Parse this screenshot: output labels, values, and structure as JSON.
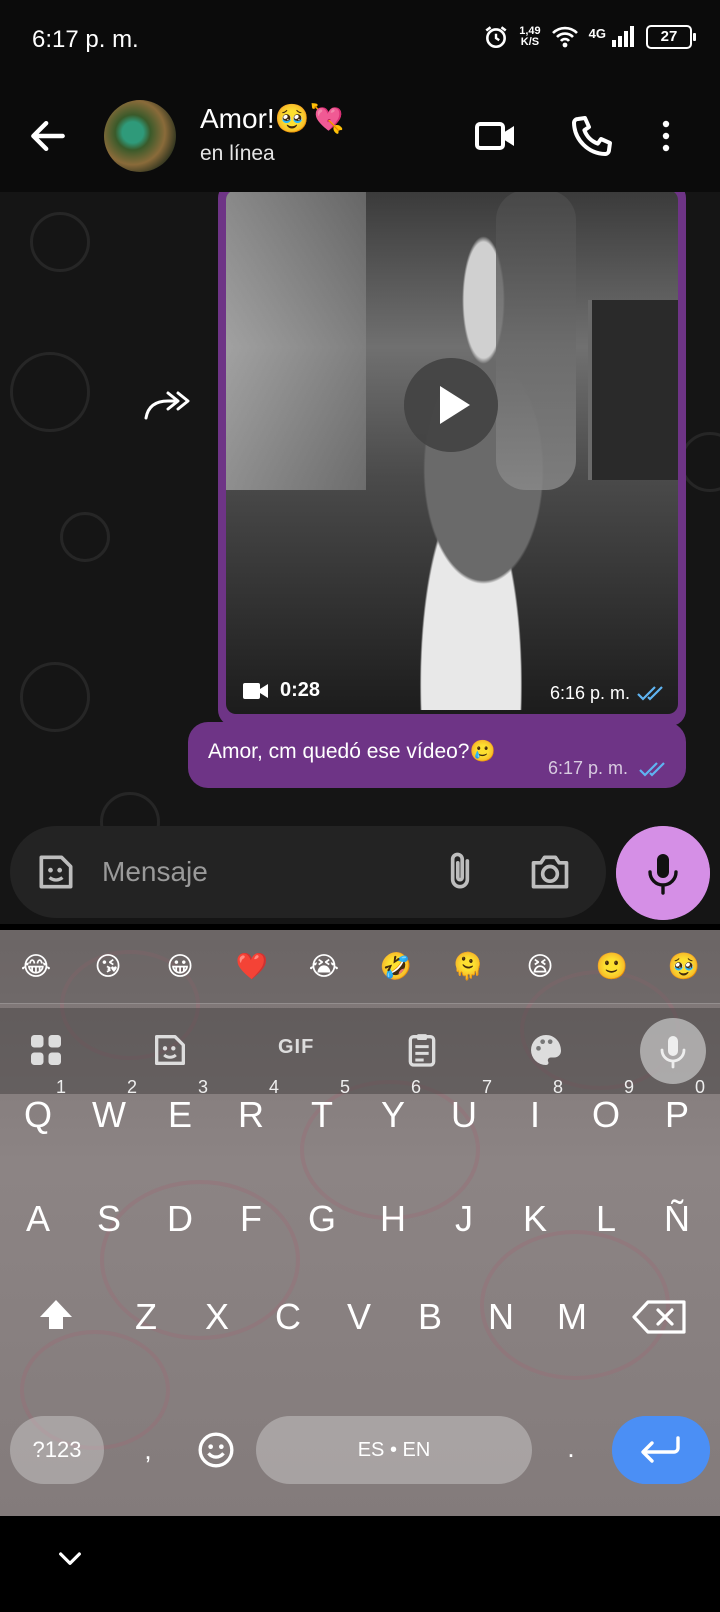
{
  "status_bar": {
    "time": "6:17 p. m.",
    "speed_value": "1,49",
    "speed_unit": "K/S",
    "network": "4G",
    "battery": "27"
  },
  "header": {
    "contact_name": "Amor!🥹💘",
    "contact_status": "en línea",
    "icons": [
      "back-arrow-icon",
      "video-call-icon",
      "voice-call-icon",
      "more-vert-icon"
    ]
  },
  "messages": {
    "video": {
      "duration": "0:28",
      "time": "6:16 p. m.",
      "status": "read"
    },
    "text": {
      "body": "Amor, cm quedó ese vídeo?🥲",
      "time": "6:17 p. m.",
      "status": "read"
    }
  },
  "composer": {
    "placeholder": "Mensaje"
  },
  "keyboard": {
    "emoji_suggestions": [
      "😂",
      "😘",
      "😀",
      "❤️",
      "😭",
      "🤣",
      "🫠",
      "😫",
      "🙂",
      "🥹"
    ],
    "toolbar": {
      "gif": "GIF"
    },
    "row1": [
      "Q",
      "W",
      "E",
      "R",
      "T",
      "Y",
      "U",
      "I",
      "O",
      "P"
    ],
    "row1_numbers": [
      "1",
      "2",
      "3",
      "4",
      "5",
      "6",
      "7",
      "8",
      "9",
      "0"
    ],
    "row2": [
      "A",
      "S",
      "D",
      "F",
      "G",
      "H",
      "J",
      "K",
      "L",
      "Ñ"
    ],
    "row3": [
      "Z",
      "X",
      "C",
      "V",
      "B",
      "N",
      "M"
    ],
    "symbols": "?123",
    "comma": ",",
    "space": "ES • EN",
    "period": "."
  },
  "colors": {
    "bubble": "#6e3486",
    "mic_button": "#d58fe6",
    "enter_key": "#4b8ff5",
    "read_ticks": "#5fb4f2"
  }
}
